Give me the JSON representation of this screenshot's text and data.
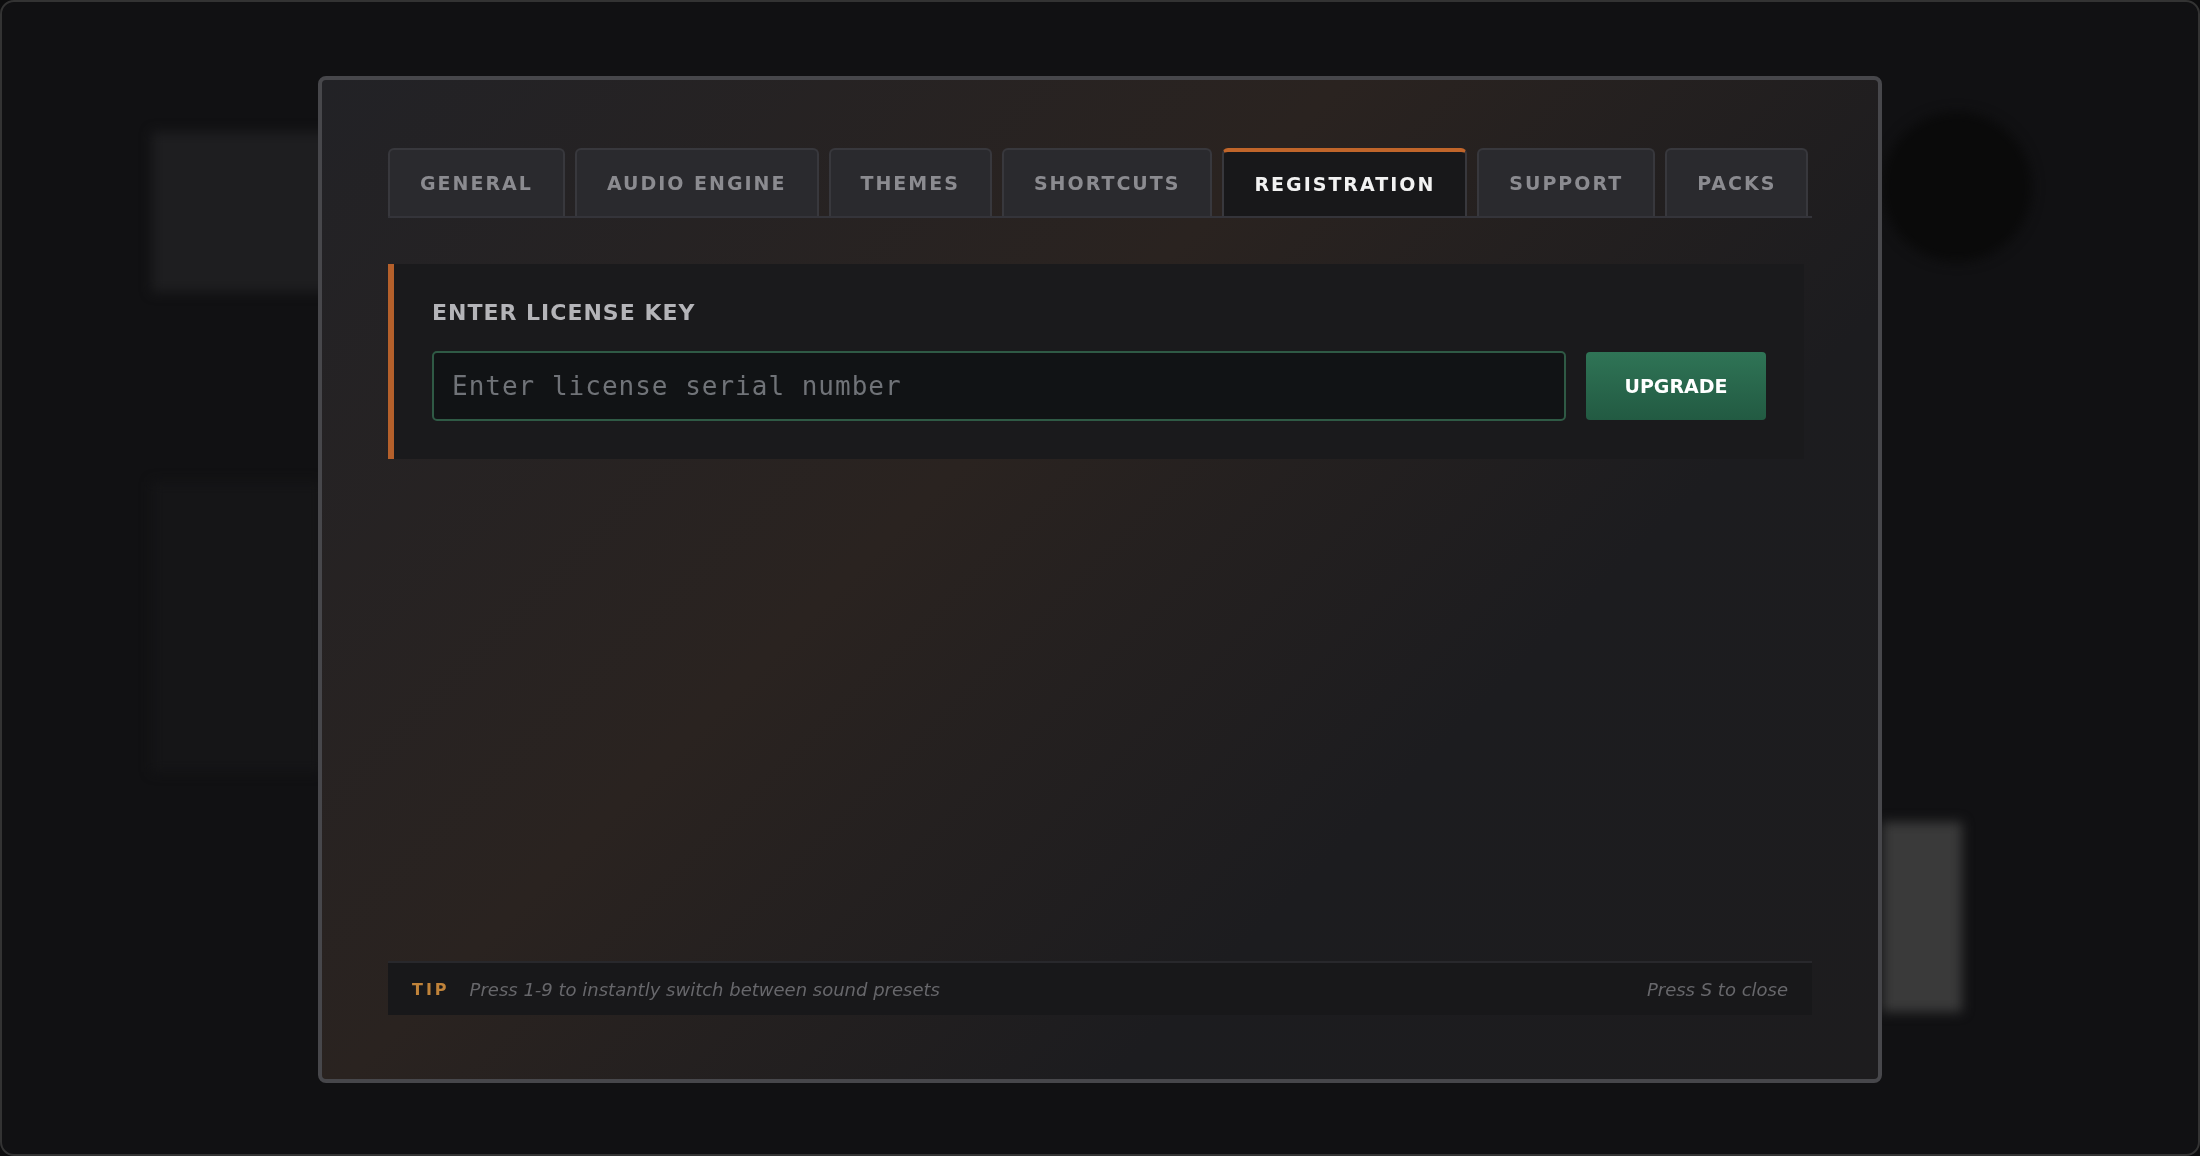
{
  "tabs": [
    {
      "label": "GENERAL",
      "selected": false
    },
    {
      "label": "AUDIO ENGINE",
      "selected": false
    },
    {
      "label": "THEMES",
      "selected": false
    },
    {
      "label": "SHORTCUTS",
      "selected": false
    },
    {
      "label": "REGISTRATION",
      "selected": true
    },
    {
      "label": "SUPPORT",
      "selected": false
    },
    {
      "label": "PACKS",
      "selected": false
    }
  ],
  "license": {
    "title": "ENTER LICENSE KEY",
    "placeholder": "Enter license serial number",
    "button": "UPGRADE"
  },
  "footer": {
    "tip_label": "TIP",
    "tip": "Press 1-9 to instantly switch between sound presets",
    "close_hint": "Press S to close"
  }
}
